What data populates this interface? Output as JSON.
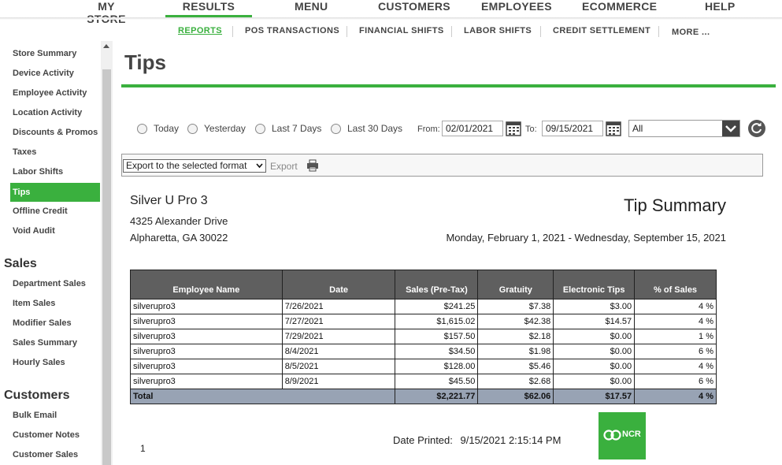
{
  "topnav": [
    {
      "label": "MY STORE",
      "active": false
    },
    {
      "label": "RESULTS",
      "active": true
    },
    {
      "label": "MENU",
      "active": false
    },
    {
      "label": "CUSTOMERS",
      "active": false
    },
    {
      "label": "EMPLOYEES",
      "active": false
    },
    {
      "label": "ECOMMERCE",
      "active": false
    },
    {
      "label": "HELP",
      "active": false
    }
  ],
  "subnav": [
    {
      "label": "REPORTS",
      "active": true
    },
    {
      "label": "POS TRANSACTIONS",
      "active": false
    },
    {
      "label": "FINANCIAL SHIFTS",
      "active": false
    },
    {
      "label": "LABOR SHIFTS",
      "active": false
    },
    {
      "label": "CREDIT SETTLEMENT",
      "active": false
    },
    {
      "label": "MORE ...",
      "active": false
    }
  ],
  "sidebar": {
    "group1": [
      "Store Summary",
      "Device Activity",
      "Employee Activity",
      "Location Activity",
      "Discounts & Promos",
      "Taxes",
      "Labor Shifts",
      "Tips",
      "Offline Credit",
      "Void Audit"
    ],
    "sales_heading": "Sales",
    "sales": [
      "Department Sales",
      "Item Sales",
      "Modifier Sales",
      "Sales Summary",
      "Hourly Sales"
    ],
    "customers_heading": "Customers",
    "customers": [
      "Bulk Email",
      "Customer Notes",
      "Customer Sales"
    ],
    "active_item": "Tips"
  },
  "page_title": "Tips",
  "filters": {
    "radios": [
      "Today",
      "Yesterday",
      "Last 7 Days",
      "Last 30 Days"
    ],
    "from_label": "From:",
    "from_value": "02/01/2021",
    "to_label": "To:",
    "to_value": "09/15/2021",
    "select_value": "All"
  },
  "export": {
    "format_select": "Export to the selected format",
    "export_label": "Export"
  },
  "report": {
    "store_name": "Silver U Pro 3",
    "address1": "4325 Alexander Drive",
    "address2": "Alpharetta, GA 30022",
    "title": "Tip Summary",
    "date_range": "Monday, February 1, 2021 - Wednesday, September 15, 2021",
    "columns": [
      "Employee Name",
      "Date",
      "Sales (Pre-Tax)",
      "Gratuity",
      "Electronic Tips",
      "% of Sales"
    ],
    "rows": [
      [
        "silverupro3",
        "7/26/2021",
        "$241.25",
        "$7.38",
        "$3.00",
        "4 %"
      ],
      [
        "silverupro3",
        "7/27/2021",
        "$1,615.02",
        "$42.38",
        "$14.57",
        "4 %"
      ],
      [
        "silverupro3",
        "7/29/2021",
        "$157.50",
        "$2.18",
        "$0.00",
        "1 %"
      ],
      [
        "silverupro3",
        "8/4/2021",
        "$34.50",
        "$1.98",
        "$0.00",
        "6 %"
      ],
      [
        "silverupro3",
        "8/5/2021",
        "$128.00",
        "$5.46",
        "$0.00",
        "4 %"
      ],
      [
        "silverupro3",
        "8/9/2021",
        "$45.50",
        "$2.68",
        "$0.00",
        "6 %"
      ]
    ],
    "total": [
      "Total",
      "$2,221.77",
      "$62.06",
      "$17.57",
      "4 %"
    ],
    "page_number": "1",
    "date_printed_label": "Date Printed:",
    "date_printed_value": "9/15/2021 2:15:14 PM",
    "logo_text": "NCR"
  },
  "colors": {
    "accent": "#3ab03e",
    "table_header": "#5f5f5f",
    "total_row": "#98a3b4"
  }
}
